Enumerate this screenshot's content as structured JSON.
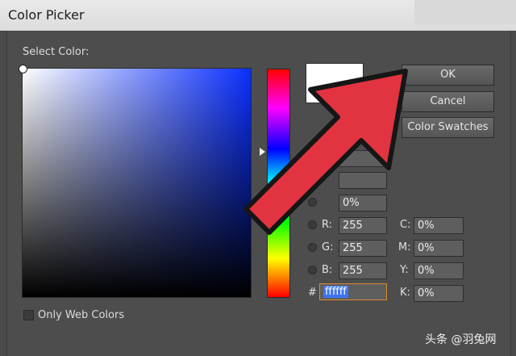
{
  "window": {
    "title": "Color Picker"
  },
  "picker": {
    "select_label": "Select Color:",
    "only_web_colors_label": "Only Web Colors",
    "only_web_colors_checked": false
  },
  "buttons": {
    "ok": "OK",
    "cancel": "Cancel",
    "swatches": "Color Swatches"
  },
  "current_color": "#ffffff",
  "fields_left": [
    {
      "label": "",
      "value": ""
    },
    {
      "label": "",
      "value": ""
    },
    {
      "label": "",
      "value": "0%"
    },
    {
      "label": "R:",
      "value": "255"
    },
    {
      "label": "G:",
      "value": "255"
    },
    {
      "label": "B:",
      "value": "255"
    }
  ],
  "hex": {
    "label": "#",
    "value": "ffffff"
  },
  "fields_right": [
    {
      "label": "C:",
      "value": "0%"
    },
    {
      "label": "M:",
      "value": "0%"
    },
    {
      "label": "Y:",
      "value": "0%"
    },
    {
      "label": "K:",
      "value": "0%"
    }
  ],
  "annotation": {
    "type": "red-arrow",
    "color": "#e13440",
    "points_to": "OK button"
  },
  "watermark": "头条 @羽兔网"
}
